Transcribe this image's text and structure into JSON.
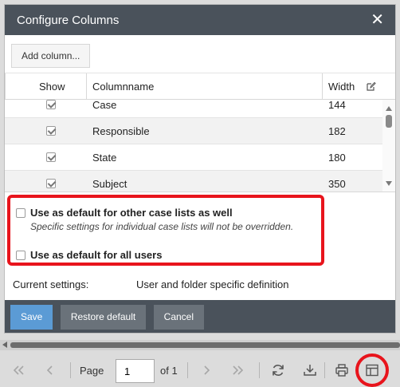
{
  "dialog": {
    "title": "Configure Columns",
    "close_icon": "close-icon"
  },
  "toolbar": {
    "add_column_label": "Add column..."
  },
  "grid": {
    "headers": {
      "show": "Show",
      "columnname": "Columnname",
      "width": "Width"
    },
    "rows": [
      {
        "name": "Case",
        "width": "144",
        "checked": true
      },
      {
        "name": "Responsible",
        "width": "182",
        "checked": true
      },
      {
        "name": "State",
        "width": "180",
        "checked": true
      },
      {
        "name": "Subject",
        "width": "350",
        "checked": true
      }
    ]
  },
  "options": {
    "default_other_lists_label": "Use as default for other case lists as well",
    "default_other_lists_note": "Specific settings for individual case lists will not be overridden.",
    "default_all_users_label": "Use as default for all users"
  },
  "settings": {
    "label": "Current settings:",
    "value": "User and folder specific definition"
  },
  "footer": {
    "save_label": "Save",
    "restore_label": "Restore default",
    "cancel_label": "Cancel"
  },
  "pager": {
    "page_label": "Page",
    "page_value": "1",
    "of_label": "of 1"
  },
  "colors": {
    "header_bg": "#4a525b",
    "primary_button": "#5b9bd5",
    "highlight_red": "#e8141c"
  }
}
